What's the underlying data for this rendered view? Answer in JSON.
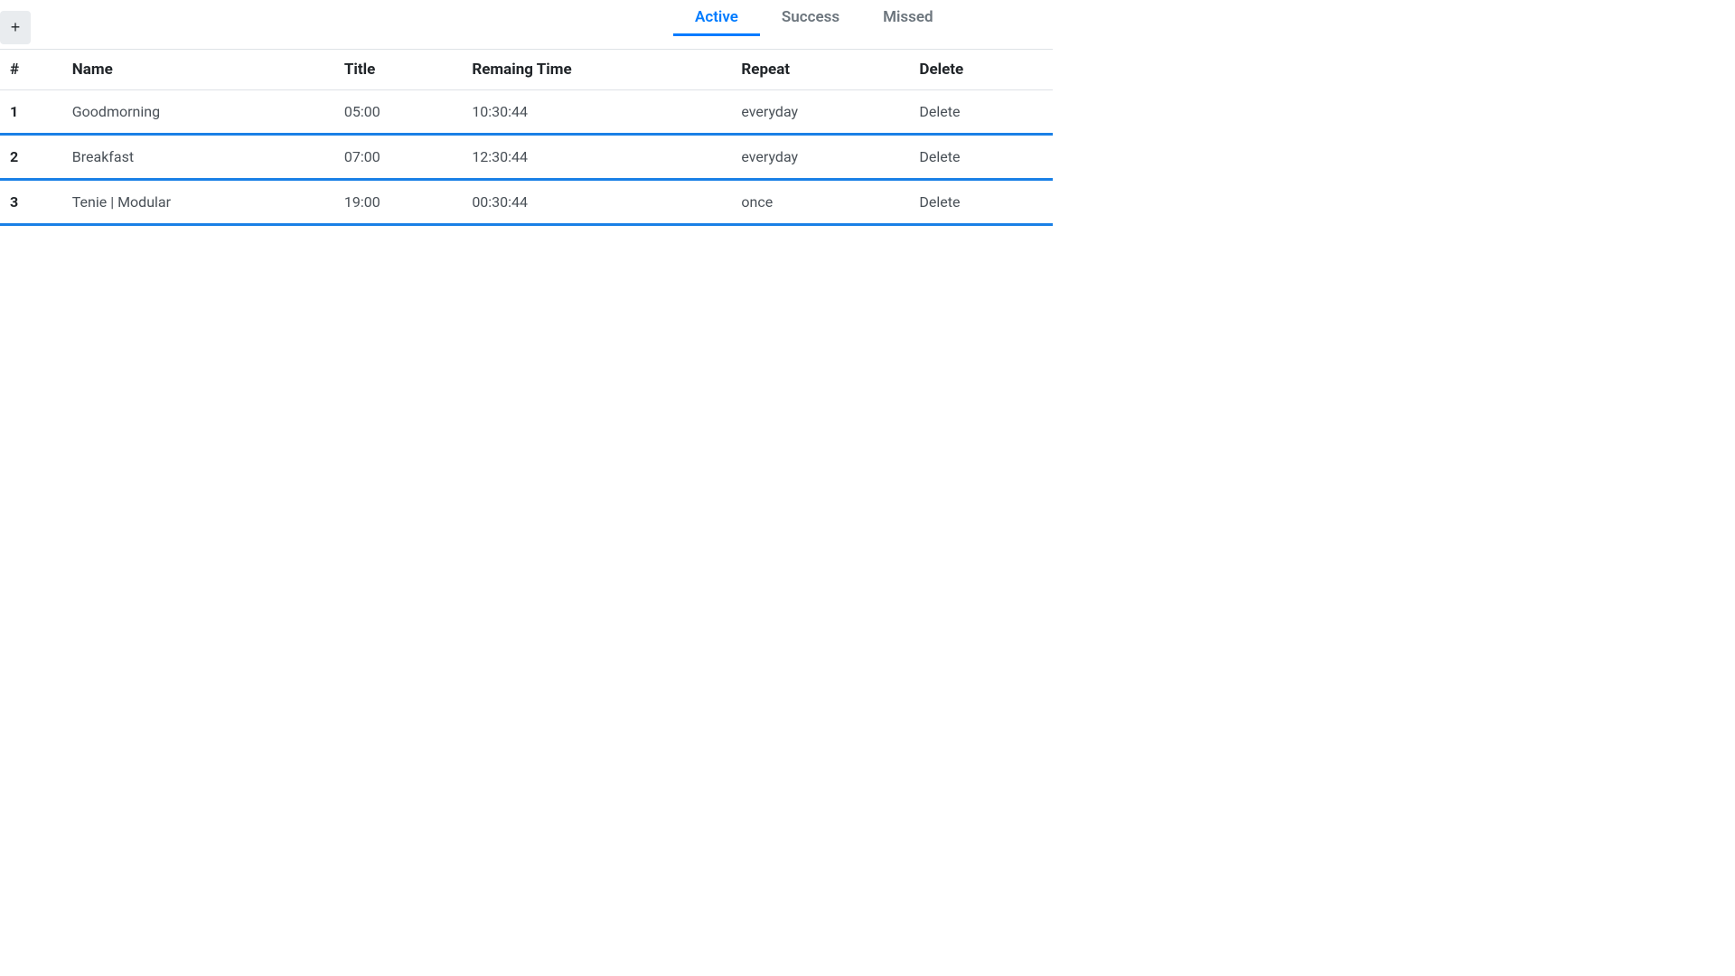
{
  "header": {
    "add_button_label": "+"
  },
  "tabs": [
    {
      "label": "Active",
      "active": true
    },
    {
      "label": "Success",
      "active": false
    },
    {
      "label": "Missed",
      "active": false
    }
  ],
  "table": {
    "headers": {
      "index": "#",
      "name": "Name",
      "title": "Title",
      "remaining": "Remaing Time",
      "repeat": "Repeat",
      "delete": "Delete"
    },
    "rows": [
      {
        "index": "1",
        "name": "Goodmorning",
        "title": "05:00",
        "remaining": "10:30:44",
        "repeat": "everyday",
        "delete": "Delete"
      },
      {
        "index": "2",
        "name": "Breakfast",
        "title": "07:00",
        "remaining": "12:30:44",
        "repeat": "everyday",
        "delete": "Delete"
      },
      {
        "index": "3",
        "name": "Tenie | Modular",
        "title": "19:00",
        "remaining": "00:30:44",
        "repeat": "once",
        "delete": "Delete"
      }
    ]
  }
}
